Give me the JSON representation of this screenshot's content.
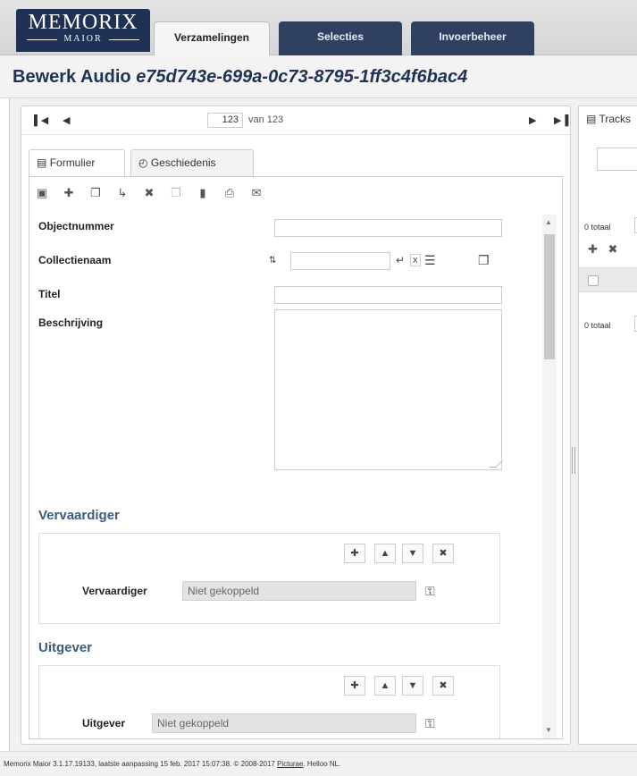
{
  "header": {
    "logo_line1": "MEMORIX",
    "logo_line2": "MAIOR",
    "tabs": [
      {
        "label": "Verzamelingen"
      },
      {
        "label": "Selecties"
      },
      {
        "label": "Invoerbeheer"
      }
    ]
  },
  "page": {
    "title_prefix": "Bewerk Audio",
    "record_id": "e75d743e-699a-0c73-8795-1ff3c4f6bac4"
  },
  "pager": {
    "first_icon": "first-page-icon",
    "prev_icon": "previous-icon",
    "current": "123",
    "of_text": "van 123",
    "next_icon": "next-icon",
    "last_icon": "last-page-icon"
  },
  "subtabs": [
    {
      "label": "Formulier",
      "icon": "form-icon"
    },
    {
      "label": "Geschiedenis",
      "icon": "history-icon"
    }
  ],
  "form": {
    "fields": [
      {
        "label": "Objectnummer",
        "value": ""
      },
      {
        "label": "Collectienaam",
        "value": ""
      },
      {
        "label": "Titel",
        "value": ""
      },
      {
        "label": "Beschrijving",
        "value": ""
      }
    ],
    "sections": [
      {
        "title": "Vervaardiger",
        "field_label": "Vervaardiger",
        "value": "Niet gekoppeld"
      },
      {
        "title": "Uitgever",
        "field_label": "Uitgever",
        "value": "Niet gekoppeld"
      }
    ]
  },
  "right_panel": {
    "title": "Tracks",
    "count_top": "0 totaal",
    "count_bottom": "0 totaal"
  },
  "footer": {
    "text": "Memorix Maior 3.1.17.19133, laatste aanpassing 15 feb. 2017 15:07:38. © 2008-2017 ",
    "link": "Picturae",
    "suffix": ". Helloo NL."
  },
  "colors": {
    "brand_navy": "#1f3154",
    "section_title": "#3b5a80"
  }
}
